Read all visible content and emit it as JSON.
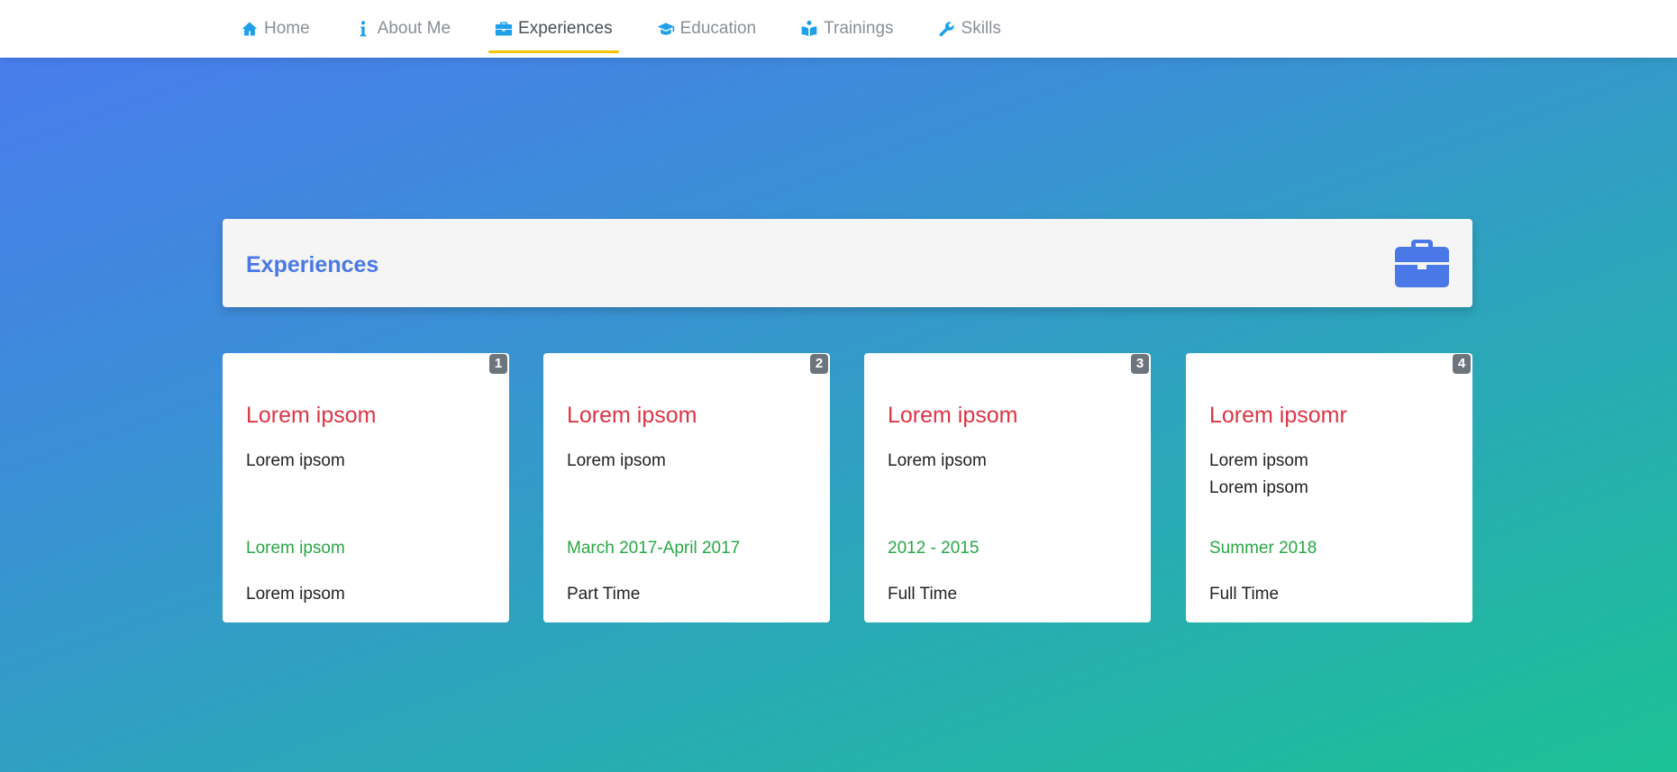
{
  "nav": {
    "items": [
      {
        "label": "Home",
        "icon": "home-icon"
      },
      {
        "label": "About Me",
        "icon": "info-icon"
      },
      {
        "label": "Experiences",
        "icon": "briefcase-icon"
      },
      {
        "label": "Education",
        "icon": "graduation-cap-icon"
      },
      {
        "label": "Trainings",
        "icon": "book-reader-icon"
      },
      {
        "label": "Skills",
        "icon": "wrench-icon"
      }
    ],
    "active": "Experiences"
  },
  "section": {
    "title": "Experiences",
    "icon": "briefcase-icon"
  },
  "cards": [
    {
      "badge": "1",
      "title": "Lorem ipsom",
      "desc": [
        "Lorem ipsom"
      ],
      "period": "Lorem ipsom",
      "type": "Lorem ipsom"
    },
    {
      "badge": "2",
      "title": "Lorem ipsom",
      "desc": [
        "Lorem ipsom"
      ],
      "period": "March 2017-April 2017",
      "type": "Part Time"
    },
    {
      "badge": "3",
      "title": "Lorem ipsom",
      "desc": [
        "Lorem ipsom"
      ],
      "period": "2012 - 2015",
      "type": "Full Time"
    },
    {
      "badge": "4",
      "title": "Lorem ipsomr",
      "desc": [
        "Lorem ipsom",
        "Lorem ipsom"
      ],
      "period": "Summer 2018",
      "type": "Full Time"
    }
  ],
  "colors": {
    "accent": "#4a78e6",
    "nav_icon": "#1ea0e8",
    "active_underline": "#f5c400",
    "card_title": "#dc3545",
    "card_period": "#28a745",
    "badge": "#6c757d"
  }
}
